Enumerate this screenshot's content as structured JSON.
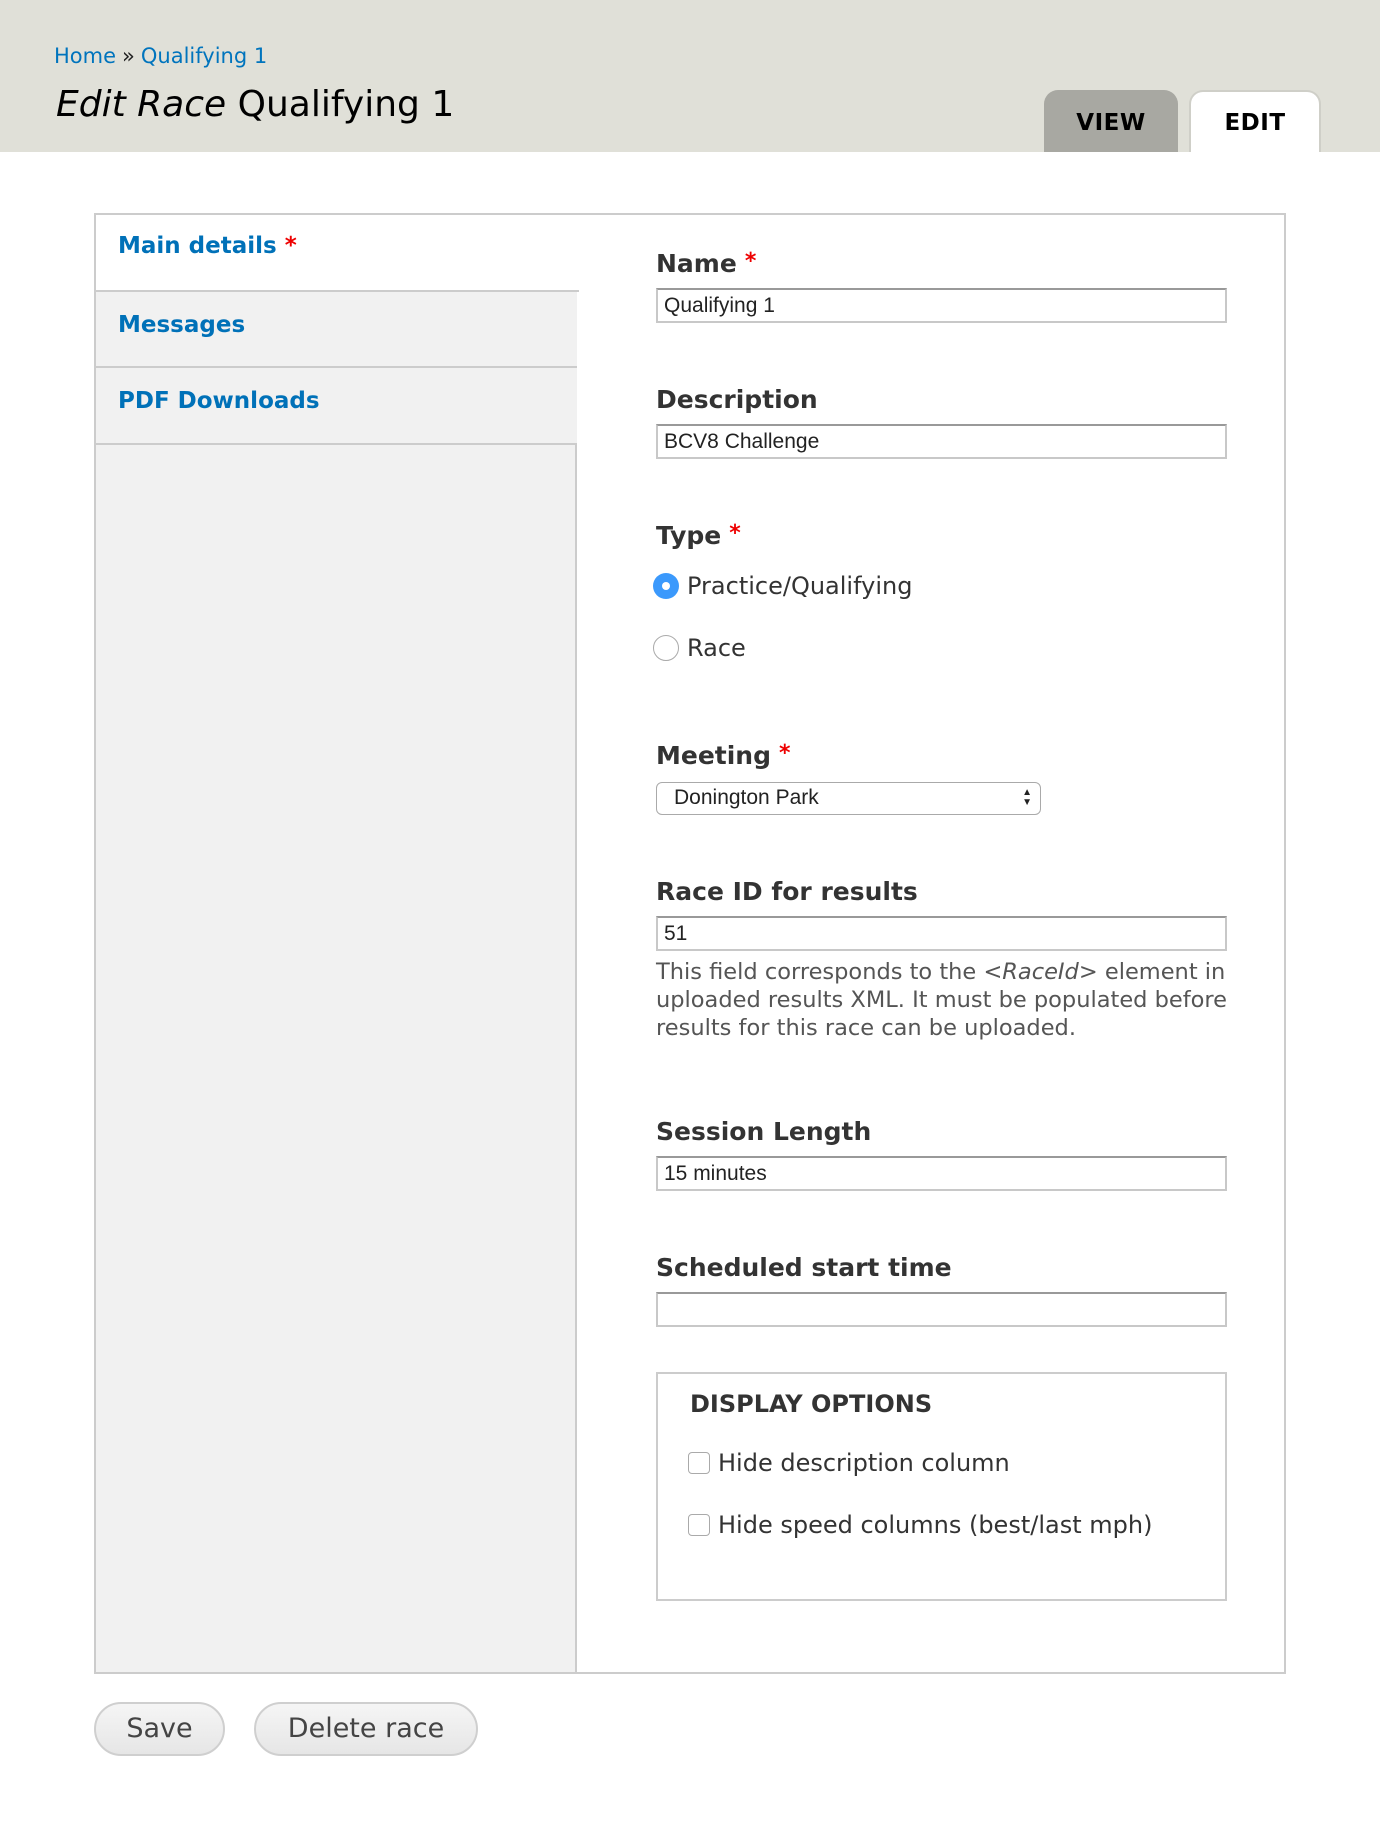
{
  "breadcrumb": {
    "items": [
      "Home",
      "Qualifying 1"
    ],
    "separator": "»"
  },
  "page_title": {
    "prefix": "Edit Race",
    "name": "Qualifying 1"
  },
  "tabs": [
    {
      "label": "VIEW",
      "active": false
    },
    {
      "label": "EDIT",
      "active": true
    }
  ],
  "sidebar": {
    "items": [
      {
        "label": "Main details",
        "required": "*",
        "active": true
      },
      {
        "label": "Messages",
        "active": false
      },
      {
        "label": "PDF Downloads",
        "active": false
      }
    ]
  },
  "form": {
    "required_mark": "*",
    "name": {
      "label": "Name",
      "value": "Qualifying 1"
    },
    "description": {
      "label": "Description",
      "value": "BCV8 Challenge"
    },
    "type": {
      "label": "Type",
      "options": [
        {
          "label": "Practice/Qualifying",
          "selected": true
        },
        {
          "label": "Race",
          "selected": false
        }
      ]
    },
    "meeting": {
      "label": "Meeting",
      "selected": "Donington Park",
      "arrow_icon": "select-arrows-icon"
    },
    "race_id": {
      "label": "Race ID for results",
      "value": "51",
      "help_before": "This field corresponds to the ",
      "help_em": "<RaceId>",
      "help_after": " element in uploaded results XML. It must be populated before results for this race can be uploaded."
    },
    "session_length": {
      "label": "Session Length",
      "value": "15 minutes"
    },
    "scheduled_start": {
      "label": "Scheduled start time",
      "value": ""
    },
    "display_options": {
      "legend": "DISPLAY OPTIONS",
      "checkboxes": [
        {
          "label": "Hide description column",
          "checked": false
        },
        {
          "label": "Hide speed columns (best/last mph)",
          "checked": false
        }
      ]
    }
  },
  "actions": {
    "save_label": "Save",
    "delete_label": "Delete race"
  },
  "colors": {
    "link": "#0074bd",
    "required": "#ee0000",
    "radio_selected": "#3b99fc",
    "header_bg": "#e0e0d8"
  }
}
